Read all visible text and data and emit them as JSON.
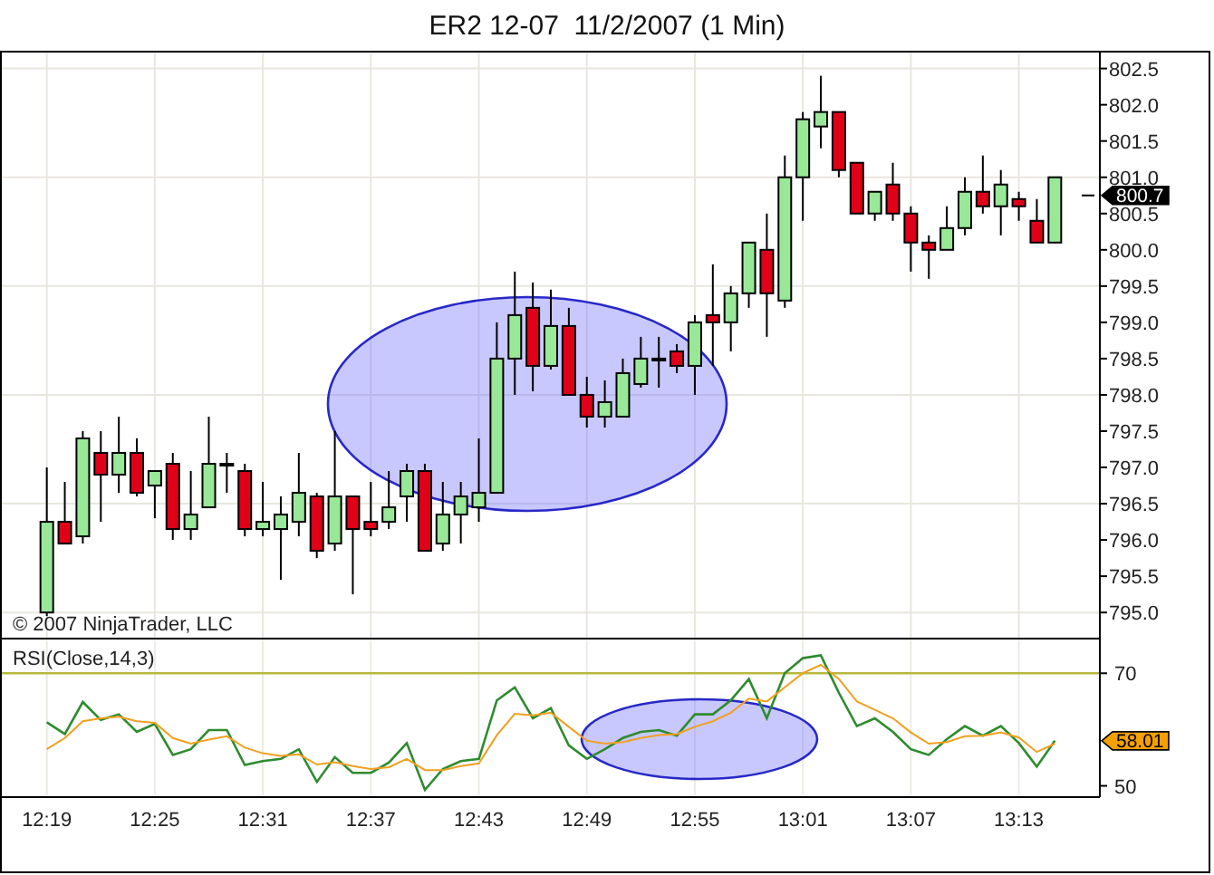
{
  "title": "ER2 12-07  11/2/2007 (1 Min)",
  "price_panel": {
    "copyright": "© 2007 NinjaTrader, LLC",
    "chart_data": {
      "type": "candlestick",
      "ylim": [
        794.64,
        802.72
      ],
      "grid": true,
      "categories": [
        null,
        null,
        null,
        null,
        null,
        null,
        null,
        null,
        null,
        null,
        null,
        null,
        null,
        null,
        null,
        null,
        null,
        null,
        null,
        null,
        null,
        null,
        null,
        null,
        null,
        null,
        null,
        null,
        null,
        null,
        null,
        null,
        null,
        null,
        null,
        null,
        null,
        null,
        null,
        null,
        null,
        null,
        null,
        null,
        null,
        null,
        null,
        null,
        null,
        null,
        null,
        null,
        null,
        null,
        null,
        null,
        null,
        null,
        null,
        null,
        null
      ],
      "ohlc": [
        null,
        null,
        [
          795.0,
          797.0,
          794.95,
          796.25
        ],
        [
          796.25,
          796.8,
          795.95,
          795.95
        ],
        [
          796.05,
          797.5,
          795.95,
          797.4
        ],
        [
          797.2,
          797.5,
          796.25,
          796.9
        ],
        [
          796.9,
          797.7,
          796.65,
          797.2
        ],
        [
          797.2,
          797.4,
          796.6,
          796.65
        ],
        [
          796.75,
          796.95,
          796.3,
          796.95
        ],
        [
          797.05,
          797.2,
          796.0,
          796.15
        ],
        [
          796.15,
          796.95,
          796.0,
          796.35
        ],
        [
          796.45,
          797.7,
          796.45,
          797.05
        ],
        [
          797.05,
          797.2,
          796.65,
          797.05
        ],
        [
          796.95,
          797.05,
          796.05,
          796.15
        ],
        [
          796.15,
          796.8,
          796.05,
          796.25
        ],
        [
          796.15,
          796.6,
          795.45,
          796.35
        ],
        [
          796.25,
          797.2,
          796.05,
          796.65
        ],
        [
          796.6,
          796.65,
          795.75,
          795.85
        ],
        [
          795.95,
          797.5,
          795.85,
          796.6
        ],
        [
          796.6,
          796.6,
          795.25,
          796.15
        ],
        [
          796.25,
          796.8,
          796.05,
          796.15
        ],
        [
          796.25,
          796.95,
          796.15,
          796.45
        ],
        [
          796.6,
          797.05,
          796.25,
          796.95
        ],
        [
          796.95,
          797.05,
          795.85,
          795.85
        ],
        [
          795.95,
          796.8,
          795.85,
          796.35
        ],
        [
          796.35,
          796.8,
          795.95,
          796.6
        ],
        [
          796.45,
          797.4,
          796.25,
          796.65
        ],
        [
          796.65,
          799.0,
          796.65,
          798.5
        ],
        [
          798.5,
          799.7,
          798.0,
          799.1
        ],
        [
          799.2,
          799.55,
          798.05,
          798.4
        ],
        [
          798.4,
          799.45,
          798.35,
          798.95
        ],
        [
          798.95,
          799.2,
          798.0,
          798.0
        ],
        [
          798.0,
          798.25,
          797.55,
          797.7
        ],
        [
          797.7,
          798.2,
          797.55,
          797.9
        ],
        [
          797.7,
          798.5,
          797.7,
          798.3
        ],
        [
          798.15,
          798.8,
          798.1,
          798.5
        ],
        [
          798.5,
          798.8,
          798.1,
          798.5
        ],
        [
          798.6,
          798.7,
          798.3,
          798.4
        ],
        [
          798.4,
          799.1,
          798.0,
          799.0
        ],
        [
          799.1,
          799.8,
          798.4,
          799.0
        ],
        [
          799.0,
          799.5,
          798.6,
          799.4
        ],
        [
          799.4,
          800.1,
          799.2,
          800.1
        ],
        [
          800.0,
          800.5,
          798.8,
          799.4
        ],
        [
          799.3,
          801.3,
          799.2,
          801.0
        ],
        [
          801.0,
          801.9,
          800.4,
          801.8
        ],
        [
          801.7,
          802.4,
          801.4,
          801.9
        ],
        [
          801.9,
          801.9,
          801.0,
          801.1
        ],
        [
          801.2,
          801.2,
          800.5,
          800.5
        ],
        [
          800.5,
          800.8,
          800.4,
          800.8
        ],
        [
          800.9,
          801.2,
          800.4,
          800.5
        ],
        [
          800.5,
          800.6,
          799.7,
          800.1
        ],
        [
          800.1,
          800.2,
          799.6,
          800.0
        ],
        [
          800.0,
          800.6,
          800.0,
          800.3
        ],
        [
          800.3,
          801.0,
          800.2,
          800.8
        ],
        [
          800.8,
          801.3,
          800.5,
          800.6
        ],
        [
          800.6,
          801.1,
          800.2,
          800.9
        ],
        [
          800.7,
          800.8,
          800.4,
          800.6
        ],
        [
          800.4,
          800.7,
          800.1,
          800.1
        ],
        [
          800.1,
          801.0,
          800.1,
          801.0
        ],
        null,
        null
      ],
      "yticks": [
        {
          "value": 802.5,
          "label": "802.5"
        },
        {
          "value": 802,
          "label": "802.0"
        },
        {
          "value": 801.5,
          "label": "801.5"
        },
        {
          "value": 801,
          "label": "801.0"
        },
        {
          "value": 800.5,
          "label": "800.5"
        },
        {
          "value": 800,
          "label": "800.0"
        },
        {
          "value": 799.5,
          "label": "799.5"
        },
        {
          "value": 799,
          "label": "799.0"
        },
        {
          "value": 798.5,
          "label": "798.5"
        },
        {
          "value": 798,
          "label": "798.0"
        },
        {
          "value": 797.5,
          "label": "797.5"
        },
        {
          "value": 797,
          "label": "797.0"
        },
        {
          "value": 796.5,
          "label": "796.5"
        },
        {
          "value": 796,
          "label": "796.0"
        },
        {
          "value": 795.5,
          "label": "795.5"
        },
        {
          "value": 795,
          "label": "795.0"
        }
      ],
      "annotations": [
        "800.7"
      ]
    }
  },
  "rsi_panel": {
    "label": "RSI(Close,14,3)",
    "chart_data": {
      "type": "line",
      "ylim": [
        48,
        76
      ],
      "grid": true,
      "categories": [
        null,
        null,
        "12:19",
        null,
        null,
        null,
        null,
        null,
        "12:25",
        null,
        null,
        null,
        null,
        null,
        "12:31",
        null,
        null,
        null,
        null,
        null,
        "12:37",
        null,
        null,
        null,
        null,
        null,
        "12:43",
        null,
        null,
        null,
        null,
        null,
        "12:49",
        null,
        null,
        null,
        null,
        null,
        "12:55",
        null,
        null,
        null,
        null,
        null,
        "13:01",
        null,
        null,
        null,
        null,
        null,
        "13:07",
        null,
        null,
        null,
        null,
        null,
        "13:13",
        null,
        null,
        null,
        null
      ],
      "series": [
        {
          "color": "#2e8b2e",
          "values": [
            null,
            null,
            61.3,
            59.2,
            64.9,
            61.7,
            62.7,
            59.6,
            61.0,
            55.5,
            56.5,
            59.9,
            59.9,
            53.7,
            54.4,
            54.8,
            56.5,
            50.7,
            55.1,
            52.3,
            52.3,
            54.1,
            57.6,
            49.3,
            53.0,
            54.4,
            54.8,
            65.2,
            67.5,
            62.0,
            63.8,
            57.2,
            54.8,
            56.5,
            58.5,
            59.6,
            59.9,
            58.9,
            62.7,
            62.7,
            65.2,
            69.0,
            62.0,
            70.0,
            72.7,
            73.2,
            66.5,
            60.6,
            62.0,
            59.6,
            56.5,
            55.5,
            58.3,
            60.6,
            58.9,
            60.6,
            57.6,
            53.4,
            58.0,
            null,
            null
          ]
        },
        {
          "color": "#f0a020",
          "values": [
            null,
            null,
            56.5,
            58.5,
            61.5,
            62.0,
            62.3,
            61.5,
            61.2,
            58.5,
            57.5,
            58.2,
            58.8,
            56.8,
            55.8,
            55.3,
            55.6,
            53.8,
            54.2,
            53.5,
            53.0,
            53.3,
            54.8,
            52.8,
            52.8,
            53.5,
            54.0,
            59.0,
            62.8,
            62.5,
            63.0,
            60.5,
            58.0,
            57.5,
            57.8,
            58.5,
            59.0,
            59.2,
            60.5,
            61.5,
            63.0,
            65.5,
            65.0,
            67.5,
            70.0,
            71.5,
            69.0,
            65.0,
            63.5,
            62.0,
            59.5,
            57.5,
            57.8,
            58.8,
            58.9,
            59.5,
            58.6,
            56.0,
            57.5,
            null,
            null
          ]
        }
      ],
      "yticks": [
        {
          "value": 70,
          "label": "70"
        },
        {
          "value": 50,
          "label": "50"
        }
      ],
      "ref_lines": [
        {
          "axis": "y",
          "value": 70
        }
      ],
      "annotations": [
        "58.01"
      ]
    }
  }
}
